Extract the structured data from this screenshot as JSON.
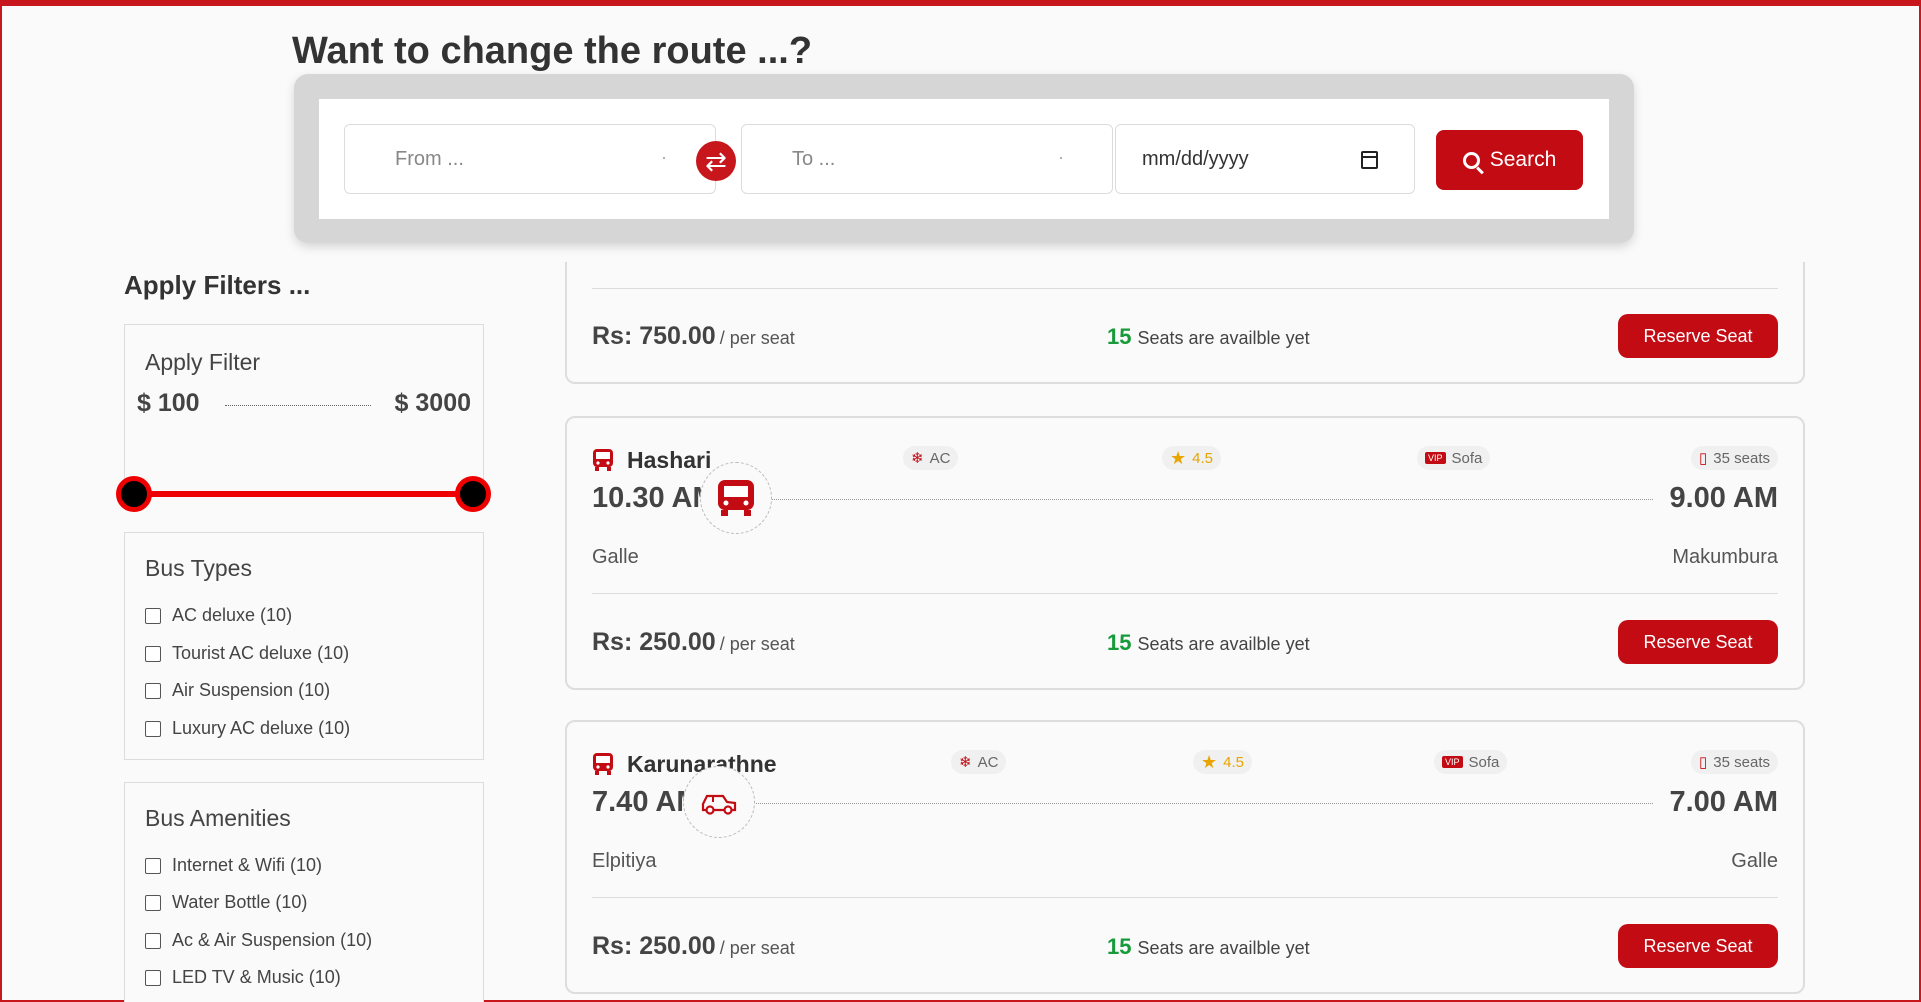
{
  "route": {
    "title": "Want to change the route ...?"
  },
  "search": {
    "from_placeholder": "From ...",
    "to_placeholder": "To ...",
    "date_placeholder": "mm/dd/yyyy",
    "button_label": "Search",
    "swap_icon": "swap-arrows-icon"
  },
  "filters": {
    "title": "Apply Filters ...",
    "price": {
      "title": "Apply Filter",
      "min_label": "$ 100",
      "max_label": "$ 3000",
      "min": 100,
      "max": 3000
    },
    "bus_types": {
      "title": "Bus Types",
      "options": [
        "AC deluxe (10)",
        "Tourist AC deluxe (10)",
        "Air Suspension (10)",
        "Luxury AC deluxe (10)"
      ]
    },
    "amenities": {
      "title": "Bus Amenities",
      "options": [
        "Internet & Wifi (10)",
        "Water Bottle (10)",
        "Ac & Air Suspension (10)",
        "LED TV & Music (10)"
      ]
    }
  },
  "results": [
    {
      "price": "Rs: 750.00",
      "per_seat": "/ per seat",
      "seats_available": "15",
      "seats_text": "Seats are availble yet",
      "reserve_label": "Reserve Seat"
    },
    {
      "name": "Hashari",
      "ac": "AC",
      "rating": "4.5",
      "seat_type": "Sofa",
      "seat_count": "35 seats",
      "depart_time": "10.30 AM",
      "arrive_time": "9.00 AM",
      "from": "Galle",
      "to": "Makumbura",
      "vehicle_icon": "bus-icon",
      "price": "Rs: 250.00",
      "per_seat": "/ per seat",
      "seats_available": "15",
      "seats_text": "Seats are availble yet",
      "reserve_label": "Reserve Seat"
    },
    {
      "name": "Karunarathne",
      "ac": "AC",
      "rating": "4.5",
      "seat_type": "Sofa",
      "seat_count": "35 seats",
      "depart_time": "7.40 AM",
      "arrive_time": "7.00 AM",
      "from": "Elpitiya",
      "to": "Galle",
      "vehicle_icon": "jeep-icon",
      "price": "Rs: 250.00",
      "per_seat": "/ per seat",
      "seats_available": "15",
      "seats_text": "Seats are availble yet",
      "reserve_label": "Reserve Seat"
    }
  ],
  "colors": {
    "brand": "#c30b13",
    "seats_green": "#169a3a",
    "rating": "#e8a400"
  }
}
